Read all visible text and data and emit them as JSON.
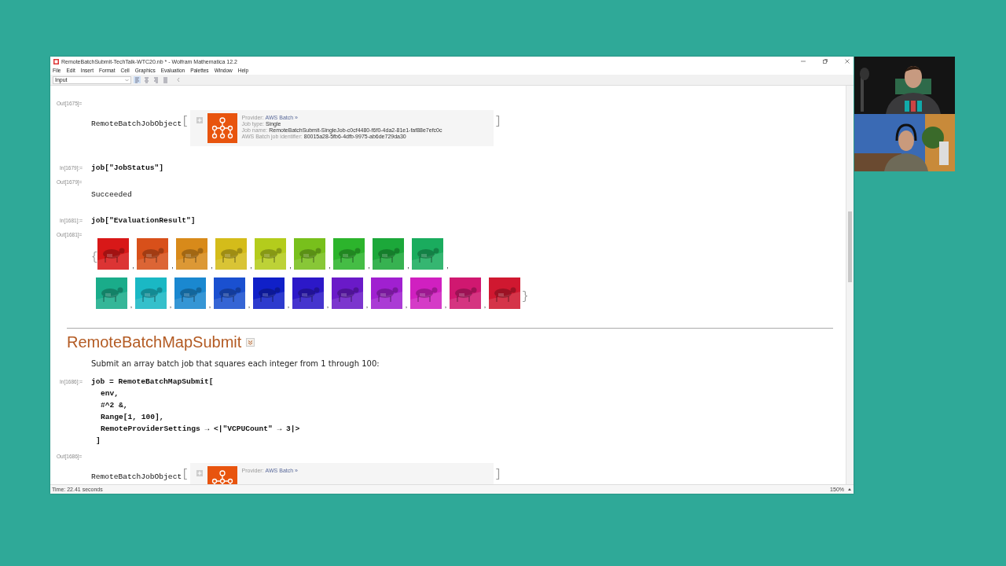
{
  "window": {
    "title": "RemoteBatchSubmit-TechTalk-WTC20.nb * - Wolfram Mathematica 12.2"
  },
  "menu": [
    "File",
    "Edit",
    "Insert",
    "Format",
    "Cell",
    "Graphics",
    "Evaluation",
    "Palettes",
    "Window",
    "Help"
  ],
  "toolbar": {
    "style": "Input",
    "alignment": [
      {
        "selected": true
      },
      {
        "selected": false
      },
      {
        "selected": false
      },
      {
        "selected": false
      }
    ]
  },
  "cells": [
    {
      "kind": "job_object",
      "label": "Out[1675]=",
      "head": "RemoteBatchJobObject",
      "open": "[",
      "close": "]",
      "fields": [
        {
          "key": "Provider:",
          "value": "AWS Batch »",
          "link": true
        },
        {
          "key": "Job type:",
          "value": "Single",
          "link": false
        },
        {
          "key": "Job name:",
          "value": "RemoteBatchSubmit-SingleJob-c0cf4480-f6f0-4da2-81e1-faf88e7efc0c",
          "link": false
        },
        {
          "key": "AWS Batch job identifier:",
          "value": "80015a28-5fb6-4dfb-9975-ab6de729da30",
          "link": false
        }
      ]
    },
    {
      "kind": "input",
      "label": "In[1679]:=",
      "code": "job[\"JobStatus\"]"
    },
    {
      "kind": "output",
      "label": "Out[1679]=",
      "text": "Succeeded"
    },
    {
      "kind": "input",
      "label": "In[1681]:=",
      "code": "job[\"EvaluationResult\"]"
    },
    {
      "kind": "images",
      "label": "Out[1681]=",
      "open": "{",
      "close": "}",
      "rows": [
        [
          {
            "kind": "picture",
            "color": "#d81818",
            "after": ","
          },
          {
            "kind": "picture",
            "color": "#d8501a",
            "after": ","
          },
          {
            "kind": "picture",
            "color": "#d88a1a",
            "after": ","
          },
          {
            "kind": "picture",
            "color": "#d4bc1a",
            "after": ","
          },
          {
            "kind": "picture",
            "color": "#b4cc1c",
            "after": ","
          },
          {
            "kind": "picture",
            "color": "#78c01c",
            "after": ","
          },
          {
            "kind": "picture",
            "color": "#2cb42c",
            "after": ","
          },
          {
            "kind": "picture",
            "color": "#1ca83a",
            "after": ","
          },
          {
            "kind": "picture",
            "color": "#1aac5e",
            "after": ","
          }
        ],
        [
          {
            "kind": "picture",
            "color": "#1aac8a",
            "after": ","
          },
          {
            "kind": "picture",
            "color": "#1ab8c4",
            "after": ","
          },
          {
            "kind": "picture",
            "color": "#1a88d0",
            "after": ","
          },
          {
            "kind": "picture",
            "color": "#1a50d0",
            "after": ","
          },
          {
            "kind": "picture",
            "color": "#1020c8",
            "after": ","
          },
          {
            "kind": "picture",
            "color": "#2c18c8",
            "after": ","
          },
          {
            "kind": "picture",
            "color": "#6a1ac8",
            "after": ","
          },
          {
            "kind": "picture",
            "color": "#a020d0",
            "after": ","
          },
          {
            "kind": "picture",
            "color": "#d020c0",
            "after": ","
          },
          {
            "kind": "picture",
            "color": "#d01870",
            "after": ","
          },
          {
            "kind": "picture",
            "color": "#d01830"
          }
        ]
      ]
    },
    {
      "kind": "section",
      "title": "RemoteBatchMapSubmit"
    },
    {
      "kind": "text",
      "text": "Submit an array batch job that squares each integer from 1 through 100:"
    },
    {
      "kind": "call",
      "label": "In[1686]:=",
      "head": "job = RemoteBatchMapSubmit[",
      "args": [
        "env,",
        "#^2 &,",
        "Range[1, 100],",
        "RemoteProviderSettings → <|\"VCPUCount\" → 3|>"
      ],
      "close": "]"
    },
    {
      "kind": "job_object",
      "label": "Out[1686]=",
      "head": "RemoteBatchJobObject",
      "open": "[",
      "close": "]",
      "fields": [
        {
          "key": "Provider:",
          "value": "AWS Batch »",
          "link": true
        }
      ]
    }
  ],
  "status_bar": {
    "time": "Time: 22.41 seconds",
    "zoom": "150%"
  },
  "webcams": [
    {
      "kind": "picture"
    },
    {
      "kind": "picture"
    }
  ]
}
